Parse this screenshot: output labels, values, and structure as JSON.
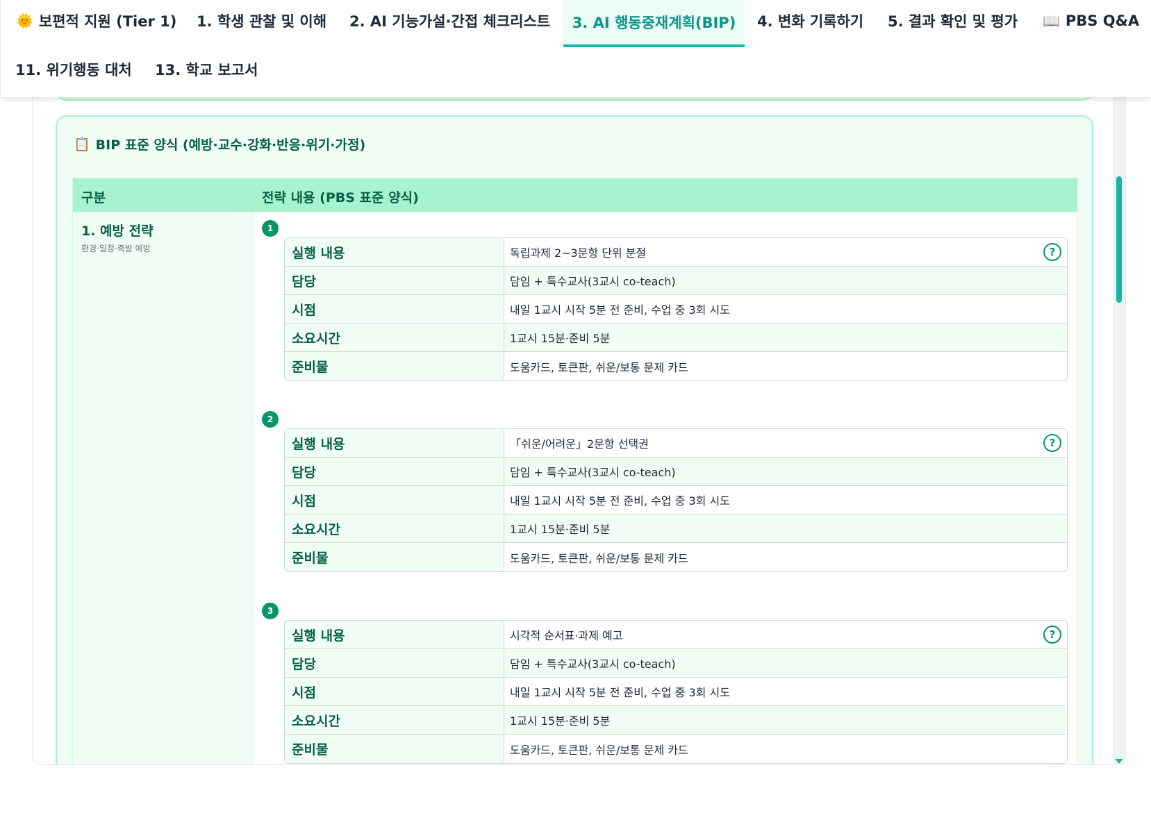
{
  "nav": {
    "tabs": [
      {
        "icon": "sun-icon",
        "glyph": "🌞",
        "label": "보편적 지원 (Tier 1)"
      },
      {
        "label": "1. 학생 관찰 및 이해"
      },
      {
        "label": "2. AI 기능가설·간접 체크리스트"
      },
      {
        "label": "3. AI 행동중재계획(BIP)",
        "active": true
      },
      {
        "label": "4. 변화 기록하기"
      },
      {
        "label": "5. 결과 확인 및 평가"
      },
      {
        "icon": "book-icon",
        "glyph": "📖",
        "label": "PBS Q&A"
      },
      {
        "label": "11. 위기행동 대처"
      },
      {
        "label": "13. 학교 보고서"
      }
    ]
  },
  "bip": {
    "title_icon": "clipboard-icon",
    "title_glyph": "📋",
    "title": "BIP 표준 양식 (예방·교수·강화·반응·위기·가정)",
    "header": {
      "col1": "구분",
      "col2": "전략 내용 (PBS 표준 양식)"
    },
    "category": {
      "title": "1. 예방 전략",
      "subtitle": "환경·일정·촉발 예방"
    },
    "labels": {
      "action": "실행 내용",
      "owner": "담당",
      "timing": "시점",
      "duration": "소요시간",
      "materials": "준비물"
    },
    "help_glyph": "?",
    "strategies": [
      {
        "num": "1",
        "action": "독립과제 2~3문항 단위 분절",
        "owner": "담임 + 특수교사(3교시 co-teach)",
        "timing": "내일 1교시 시작 5분 전 준비, 수업 중 3회 시도",
        "duration": "1교시 15분·준비 5분",
        "materials": "도움카드, 토큰판, 쉬운/보통 문제 카드"
      },
      {
        "num": "2",
        "action": "「쉬운/어려운」2문항 선택권",
        "owner": "담임 + 특수교사(3교시 co-teach)",
        "timing": "내일 1교시 시작 5분 전 준비, 수업 중 3회 시도",
        "duration": "1교시 15분·준비 5분",
        "materials": "도움카드, 토큰판, 쉬운/보통 문제 카드"
      },
      {
        "num": "3",
        "action": "시각적 순서표·과제 예고",
        "owner": "담임 + 특수교사(3교시 co-teach)",
        "timing": "내일 1교시 시작 5분 전 준비, 수업 중 3회 시도",
        "duration": "1교시 15분·준비 5분",
        "materials": "도움카드, 토큰판, 쉬운/보통 문제 카드"
      }
    ]
  },
  "colors": {
    "accent": "#14b8a6",
    "green_dark": "#065f46",
    "green_light": "#f0fdf4",
    "header_bg": "#a7f3d0"
  }
}
